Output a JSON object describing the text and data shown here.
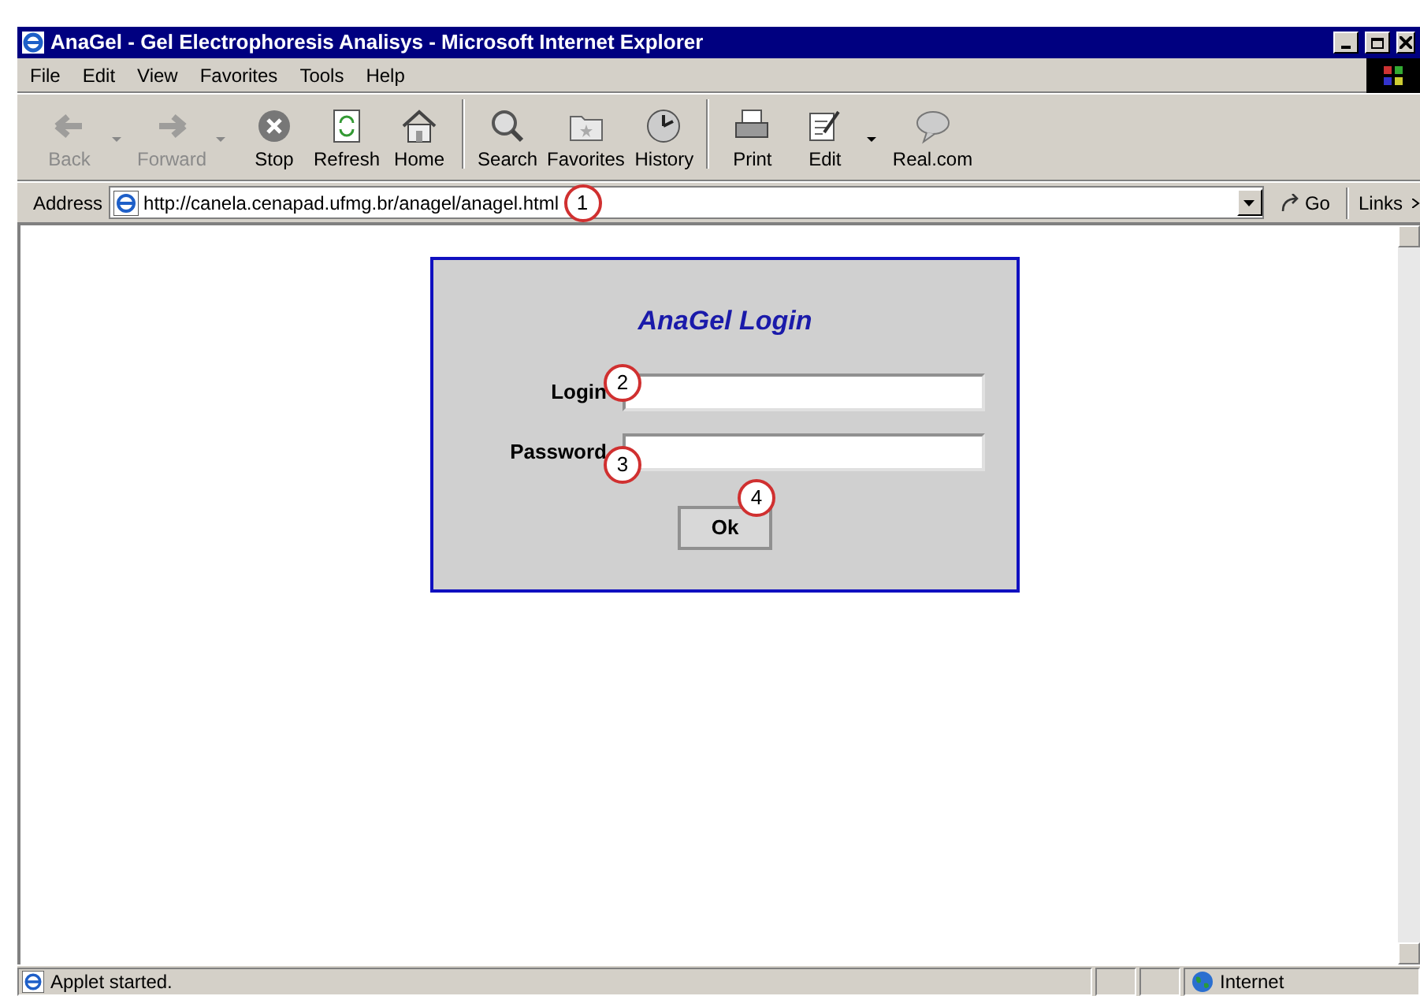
{
  "window": {
    "title": "AnaGel - Gel Electrophoresis Analisys - Microsoft Internet Explorer"
  },
  "menu": [
    "File",
    "Edit",
    "View",
    "Favorites",
    "Tools",
    "Help"
  ],
  "toolbar": [
    {
      "label": "Back",
      "kind": "back",
      "disabled": true,
      "dropdown": true
    },
    {
      "label": "Forward",
      "kind": "forward",
      "disabled": true,
      "dropdown": true
    },
    {
      "label": "Stop",
      "kind": "stop",
      "disabled": false,
      "dropdown": false
    },
    {
      "label": "Refresh",
      "kind": "refresh",
      "disabled": false,
      "dropdown": false
    },
    {
      "label": "Home",
      "kind": "home",
      "disabled": false,
      "dropdown": false
    },
    {
      "label": "Search",
      "kind": "search",
      "disabled": false,
      "dropdown": false,
      "sep": true
    },
    {
      "label": "Favorites",
      "kind": "favorites",
      "disabled": false,
      "dropdown": false
    },
    {
      "label": "History",
      "kind": "history",
      "disabled": false,
      "dropdown": false
    },
    {
      "label": "Print",
      "kind": "print",
      "disabled": false,
      "dropdown": false,
      "sep": true
    },
    {
      "label": "Edit",
      "kind": "edit",
      "disabled": false,
      "dropdown": true
    },
    {
      "label": "Real.com",
      "kind": "real",
      "disabled": false,
      "dropdown": false
    }
  ],
  "address_bar": {
    "label": "Address",
    "url": "http://canela.cenapad.ufmg.br/anagel/anagel.html",
    "go": "Go",
    "links": "Links"
  },
  "login": {
    "title": "AnaGel Login",
    "fields": [
      {
        "label": "Login"
      },
      {
        "label": "Password"
      }
    ],
    "button": "Ok"
  },
  "callouts": [
    "1",
    "2",
    "3",
    "4"
  ],
  "status_bar": {
    "text": "Applet started.",
    "zone": "Internet"
  }
}
